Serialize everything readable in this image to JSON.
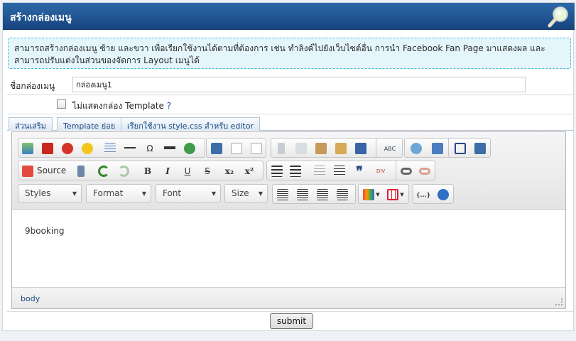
{
  "header": {
    "title": "สร้างกล่องเมนู",
    "icon": "magnifier-icon"
  },
  "notice": {
    "text": "สามารถสร้างกล่องเมนู ซ้าย และขวา เพื่อเรียกใช้งานได้ตามที่ต้องการ เช่น ทำลิงค์ไปยังเว็บไซต์อื่น การนำ Facebook Fan Page มาแสดงผล และสามารถปรับแต่งในส่วนของจัดการ Layout เมนูได้"
  },
  "form": {
    "name_label": "ชื่อกล่องเมนู",
    "name_value": "กล่องเมนู1",
    "hide_template_label": "ไม่แสดงกล่อง Template",
    "hide_template_checked": false,
    "help_mark": "?"
  },
  "tabs": [
    {
      "label": "ส่วนเสริม"
    },
    {
      "label": "Template ย่อย"
    },
    {
      "label": "เรียกใช้งาน style.css สำหรับ editor"
    }
  ],
  "toolbar": {
    "source_label": "Source",
    "combos": {
      "styles": "Styles",
      "format": "Format",
      "font": "Font",
      "size": "Size"
    },
    "bold": "B",
    "italic": "I",
    "underline": "U",
    "strike": "S",
    "subscript": "x₂",
    "superscript": "x²",
    "omega": "Ω",
    "blockquote": "❞",
    "spellcheck": "ABC",
    "div": "DIV",
    "code": "{...}"
  },
  "editor": {
    "content": "9booking",
    "path": "body"
  },
  "actions": {
    "submit": "submit"
  },
  "colors": {
    "header_top": "#2e69a8",
    "header_bottom": "#16457f",
    "notice_border": "#46b7d9",
    "notice_bg": "#e4f6fc"
  }
}
